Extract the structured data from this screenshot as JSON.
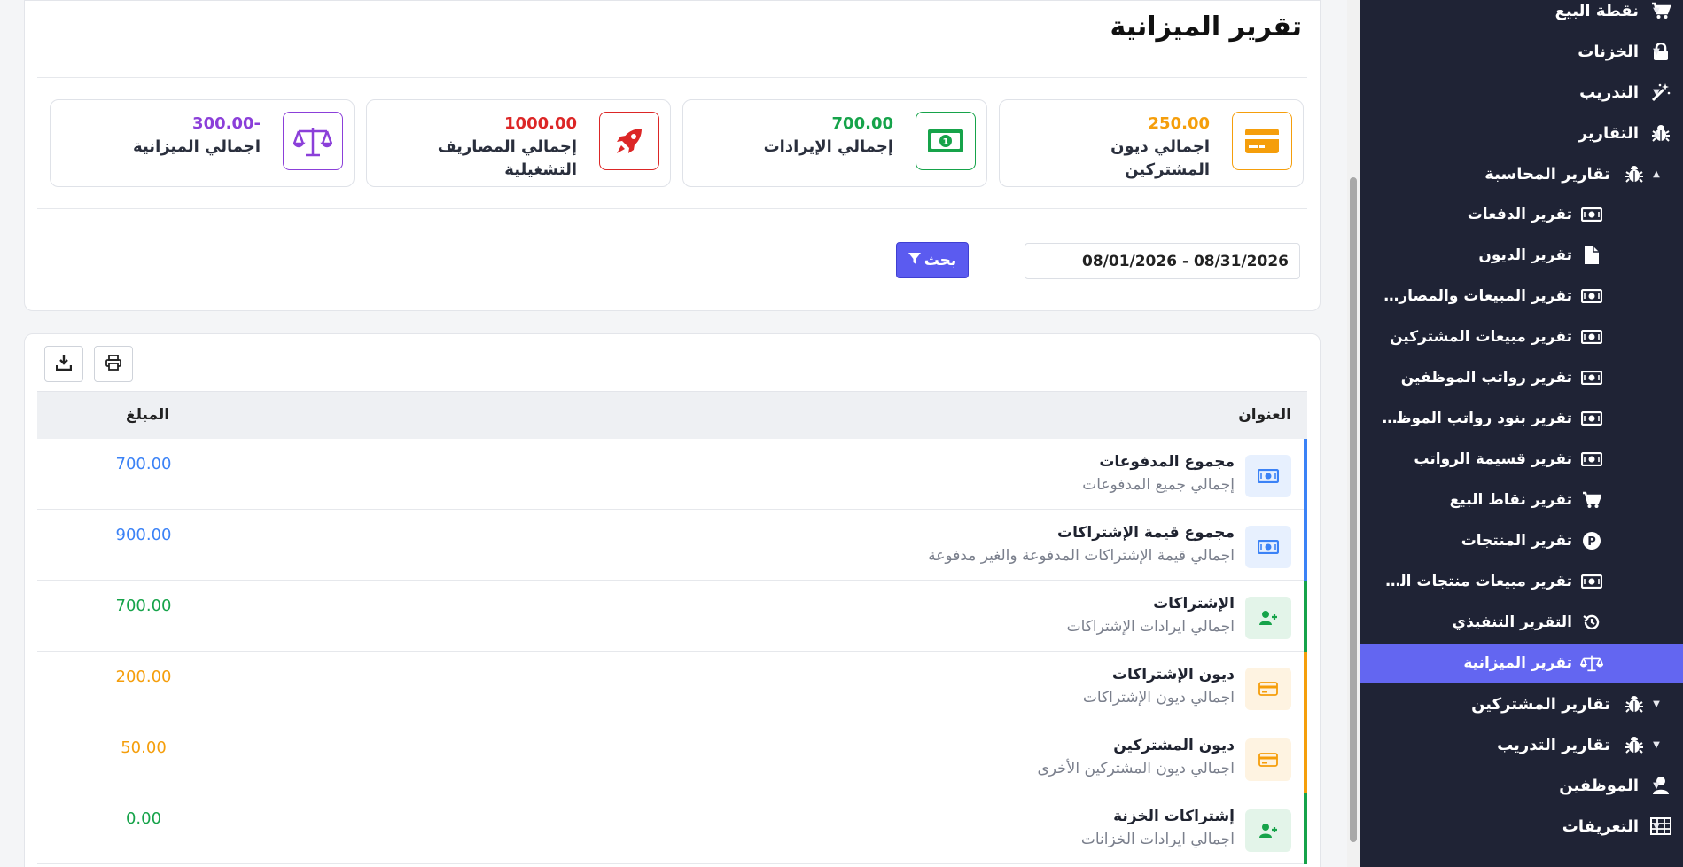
{
  "page_title": "تقرير الميزانية",
  "colors": {
    "sidebar_bg": "#1f2335",
    "sidebar_active": "#6366f1",
    "primary": "#5b5bf0",
    "orange": "#f59e0b",
    "green": "#16a34a",
    "red": "#dc2626",
    "purple": "#8b3fd9",
    "blue": "#3b82f6"
  },
  "stats": [
    {
      "value": "250.00",
      "label": "اجمالي ديون المشتركين",
      "icon": "credit-card-icon",
      "color": "#f59e0b"
    },
    {
      "value": "700.00",
      "label": "إجمالي الإيرادات",
      "icon": "money-bill-icon",
      "color": "#16a34a"
    },
    {
      "value": "1000.00",
      "label": "إجمالي المصاريف التشغيلية",
      "icon": "rocket-icon",
      "color": "#dc2626"
    },
    {
      "value": "-300.00",
      "label": "اجمالي الميزانية",
      "icon": "balance-scale-icon",
      "color": "#8b3fd9"
    }
  ],
  "filter": {
    "date_range": "08/01/2026 - 08/31/2026",
    "search_label": "بحث"
  },
  "table": {
    "col_title": "العنوان",
    "col_amount": "المبلغ",
    "rows": [
      {
        "title": "مجموع المدفوعات",
        "subtitle": "إجمالي جميع المدفوعات",
        "amount": "700.00",
        "icon": "money-bill-icon",
        "color": "#3b82f6"
      },
      {
        "title": "مجموع قيمة الإشتراكات",
        "subtitle": "اجمالي قيمة الإشتراكات المدفوعة والغير مدفوعة",
        "amount": "900.00",
        "icon": "money-bill-icon",
        "color": "#3b82f6"
      },
      {
        "title": "الإشتراكات",
        "subtitle": "اجمالي ايرادات الإشتراكات",
        "amount": "700.00",
        "icon": "user-plus-icon",
        "color": "#16a34a"
      },
      {
        "title": "ديون الإشتراكات",
        "subtitle": "اجمالي ديون الإشتراكات",
        "amount": "200.00",
        "icon": "credit-card-icon",
        "color": "#f59e0b"
      },
      {
        "title": "ديون المشتركين",
        "subtitle": "اجمالي ديون المشتركين الأخرى",
        "amount": "50.00",
        "icon": "credit-card-icon",
        "color": "#f59e0b"
      },
      {
        "title": "إشتراكات الخزنة",
        "subtitle": "اجمالي ايرادات الخزانات",
        "amount": "0.00",
        "icon": "user-plus-icon",
        "color": "#16a34a"
      }
    ]
  },
  "sidebar": {
    "items": [
      {
        "label": "نقطة البيع",
        "icon": "cart-icon",
        "level": "top",
        "caret": "▼"
      },
      {
        "label": "الخزنات",
        "icon": "lock-icon",
        "level": "top",
        "caret": "▼"
      },
      {
        "label": "التدريب",
        "icon": "magic-wand-icon",
        "level": "top",
        "caret": "▼"
      },
      {
        "label": "التقارير",
        "icon": "bug-icon",
        "level": "top",
        "caret": "▲"
      },
      {
        "label": "تقارير المحاسبة",
        "icon": "bug-icon",
        "level": "sub",
        "caret": "▲"
      },
      {
        "label": "تقرير الدفعات",
        "icon": "money-bill-icon",
        "level": "sub2",
        "caret": ""
      },
      {
        "label": "تقرير الديون",
        "icon": "file-icon",
        "level": "sub2",
        "caret": ""
      },
      {
        "label": "تقرير المبيعات والمصاريف",
        "icon": "money-bill-icon",
        "level": "sub2",
        "caret": ""
      },
      {
        "label": "تقرير مبيعات المشتركين",
        "icon": "money-bill-icon",
        "level": "sub2",
        "caret": ""
      },
      {
        "label": "تقرير رواتب الموظفين",
        "icon": "money-bill-icon",
        "level": "sub2",
        "caret": ""
      },
      {
        "label": "تقرير بنود رواتب الموظفين",
        "icon": "money-bill-icon",
        "level": "sub2",
        "caret": ""
      },
      {
        "label": "تقرير قسيمة الرواتب",
        "icon": "money-bill-icon",
        "level": "sub2",
        "caret": ""
      },
      {
        "label": "تقرير نقاط البيع",
        "icon": "cart-icon",
        "level": "sub2",
        "caret": ""
      },
      {
        "label": "تقرير المنتجات",
        "icon": "parking-icon",
        "level": "sub2",
        "caret": ""
      },
      {
        "label": "تقرير مبيعات منتجات الم...",
        "icon": "money-bill-icon",
        "level": "sub2",
        "caret": ""
      },
      {
        "label": "التقرير التنفيذي",
        "icon": "history-icon",
        "level": "sub2",
        "caret": ""
      },
      {
        "label": "تقرير الميزانية",
        "icon": "balance-scale-icon",
        "level": "sub2",
        "caret": "",
        "active": true
      },
      {
        "label": "تقارير المشتركين",
        "icon": "bug-icon",
        "level": "sub",
        "caret": "▼"
      },
      {
        "label": "تقارير التدريب",
        "icon": "bug-icon",
        "level": "sub",
        "caret": "▼"
      },
      {
        "label": "الموظفين",
        "icon": "user-icon",
        "level": "top",
        "caret": "▼"
      },
      {
        "label": "التعريفات",
        "icon": "table-icon",
        "level": "top",
        "caret": "▼"
      }
    ]
  }
}
